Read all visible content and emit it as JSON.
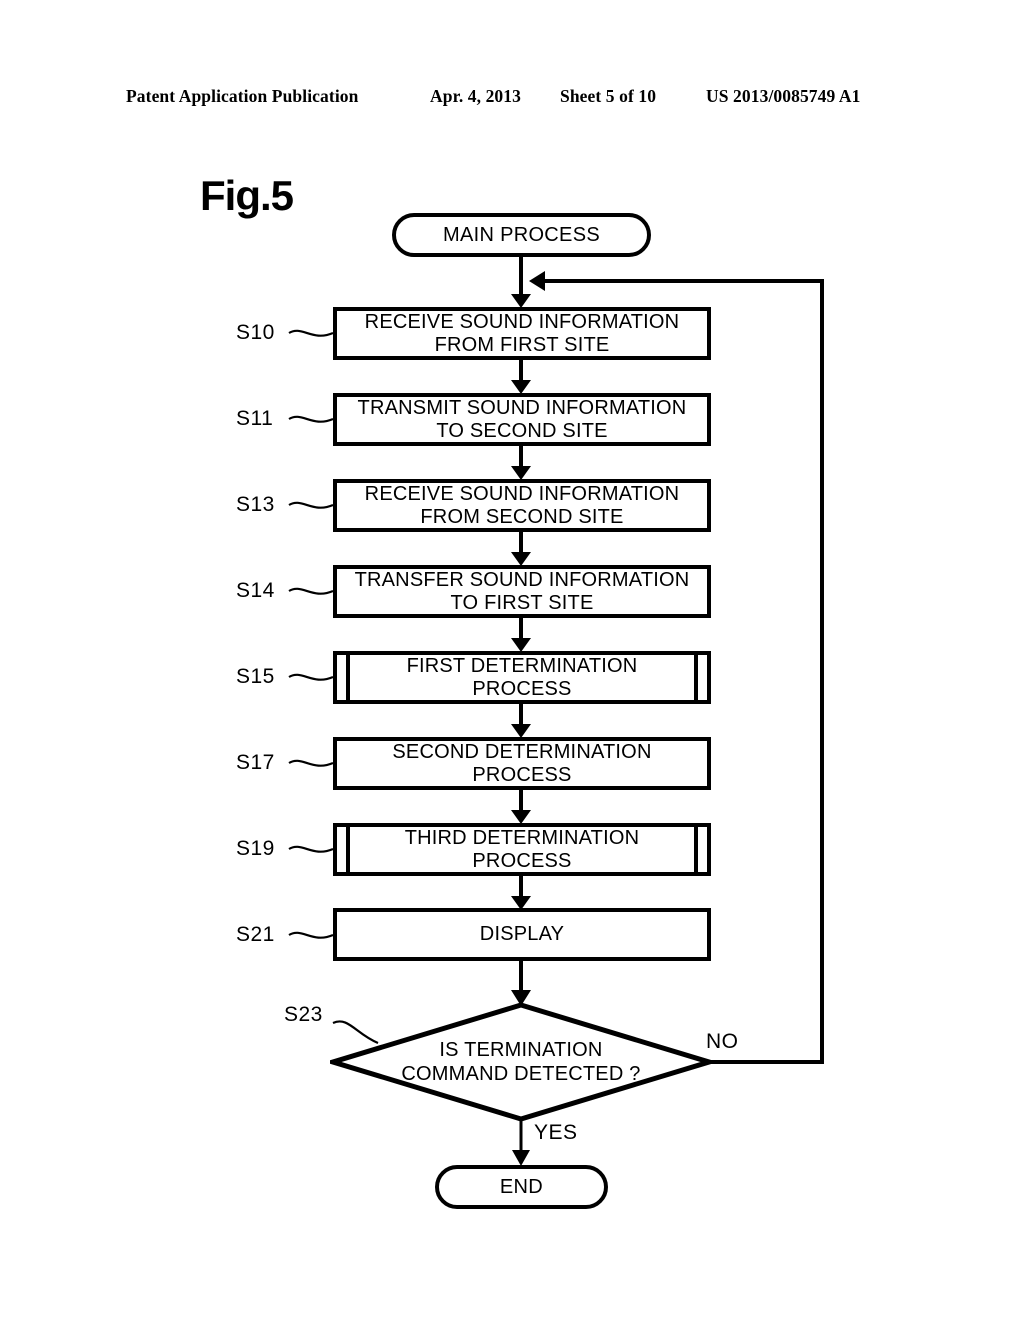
{
  "header": {
    "publication": "Patent Application Publication",
    "date": "Apr. 4, 2013",
    "sheet": "Sheet 5 of 10",
    "patent_number": "US 2013/0085749 A1"
  },
  "figure": {
    "label": "Fig.5"
  },
  "flowchart": {
    "start": {
      "label": "MAIN PROCESS"
    },
    "end": {
      "label": "END"
    },
    "steps": [
      {
        "id": "S10",
        "line1": "RECEIVE SOUND INFORMATION",
        "line2": "FROM FIRST SITE",
        "shape": "process"
      },
      {
        "id": "S11",
        "line1": "TRANSMIT SOUND INFORMATION",
        "line2": "TO SECOND SITE",
        "shape": "process"
      },
      {
        "id": "S13",
        "line1": "RECEIVE SOUND INFORMATION",
        "line2": "FROM SECOND SITE",
        "shape": "process"
      },
      {
        "id": "S14",
        "line1": "TRANSFER SOUND INFORMATION",
        "line2": "TO FIRST SITE",
        "shape": "process"
      },
      {
        "id": "S15",
        "line1": "FIRST DETERMINATION",
        "line2": "PROCESS",
        "shape": "predefined-process"
      },
      {
        "id": "S17",
        "line1": "SECOND DETERMINATION",
        "line2": "PROCESS",
        "shape": "process"
      },
      {
        "id": "S19",
        "line1": "THIRD DETERMINATION",
        "line2": "PROCESS",
        "shape": "predefined-process"
      },
      {
        "id": "S21",
        "line1": "DISPLAY",
        "line2": "",
        "shape": "process"
      }
    ],
    "decision": {
      "id": "S23",
      "line1": "IS TERMINATION",
      "line2": "COMMAND  DETECTED ?",
      "branch_no": "NO",
      "branch_yes": "YES"
    }
  },
  "colors": {
    "ink": "#000000",
    "paper": "#ffffff"
  }
}
